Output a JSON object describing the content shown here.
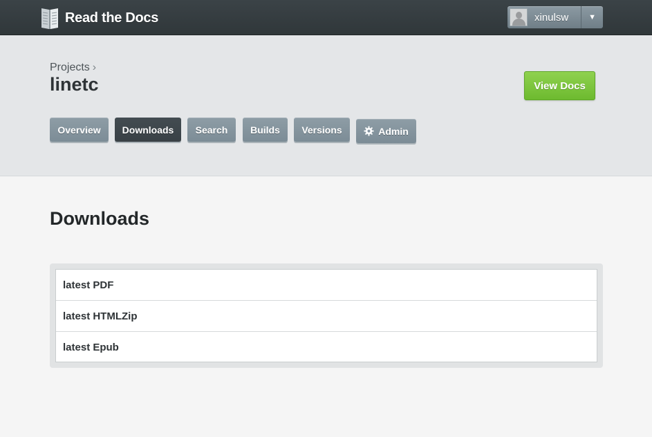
{
  "topbar": {
    "logo_text": "Read the Docs",
    "logo_icon": "book-icon",
    "user": {
      "name": "xinulsw",
      "avatar_icon": "default-avatar",
      "dropdown_icon": "▼"
    }
  },
  "header": {
    "breadcrumb": {
      "link": "Projects",
      "separator": "›"
    },
    "project_title": "linetc",
    "view_docs_label": "View Docs",
    "tabs": [
      {
        "label": "Overview",
        "active": false
      },
      {
        "label": "Downloads",
        "active": true
      },
      {
        "label": "Search",
        "active": false
      },
      {
        "label": "Builds",
        "active": false
      },
      {
        "label": "Versions",
        "active": false
      },
      {
        "label": "Admin",
        "active": false,
        "icon": "gear-icon"
      }
    ]
  },
  "main": {
    "title": "Downloads",
    "downloads": [
      {
        "label": "latest PDF"
      },
      {
        "label": "latest HTMLZip"
      },
      {
        "label": "latest Epub"
      }
    ]
  },
  "colors": {
    "topbar": "#343b3f",
    "tab": "#8493a0",
    "tab_active": "#3e464b",
    "view_docs": "#7bc43a",
    "header_bg": "#e4e6e8",
    "page_bg": "#f5f5f5"
  }
}
